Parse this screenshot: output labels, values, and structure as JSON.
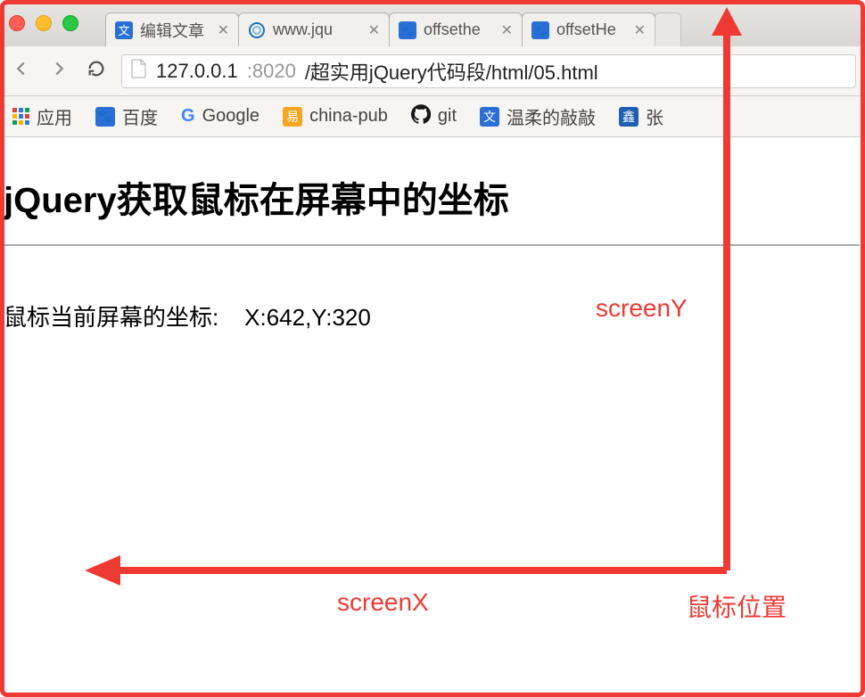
{
  "chrome": {
    "tabs": [
      {
        "label": "编辑文章",
        "favicon": "blue-wiki"
      },
      {
        "label": "www.jqu",
        "favicon": "jquery"
      },
      {
        "label": "offsethe",
        "favicon": "baidu"
      },
      {
        "label": "offsetHe",
        "favicon": "baidu"
      }
    ],
    "url": {
      "host": "127.0.0.1",
      "port": ":8020",
      "path": "/超实用jQuery代码段/html/05.html"
    },
    "bookmarks": [
      {
        "label": "应用",
        "icon": "apps"
      },
      {
        "label": "百度",
        "icon": "baidu"
      },
      {
        "label": "Google",
        "icon": "google"
      },
      {
        "label": "china-pub",
        "icon": "chinapub"
      },
      {
        "label": "git",
        "icon": "github"
      },
      {
        "label": "温柔的敲敲",
        "icon": "blue-wiki"
      },
      {
        "label": "张",
        "icon": "bluebox"
      }
    ]
  },
  "page": {
    "heading": "jQuery获取鼠标在屏幕中的坐标",
    "coord_label": "鼠标当前屏幕的坐标:",
    "coord_value": "X:642,Y:320"
  },
  "annotations": {
    "screenY": "screenY",
    "screenX": "screenX",
    "mouse_pos": "鼠标位置"
  }
}
